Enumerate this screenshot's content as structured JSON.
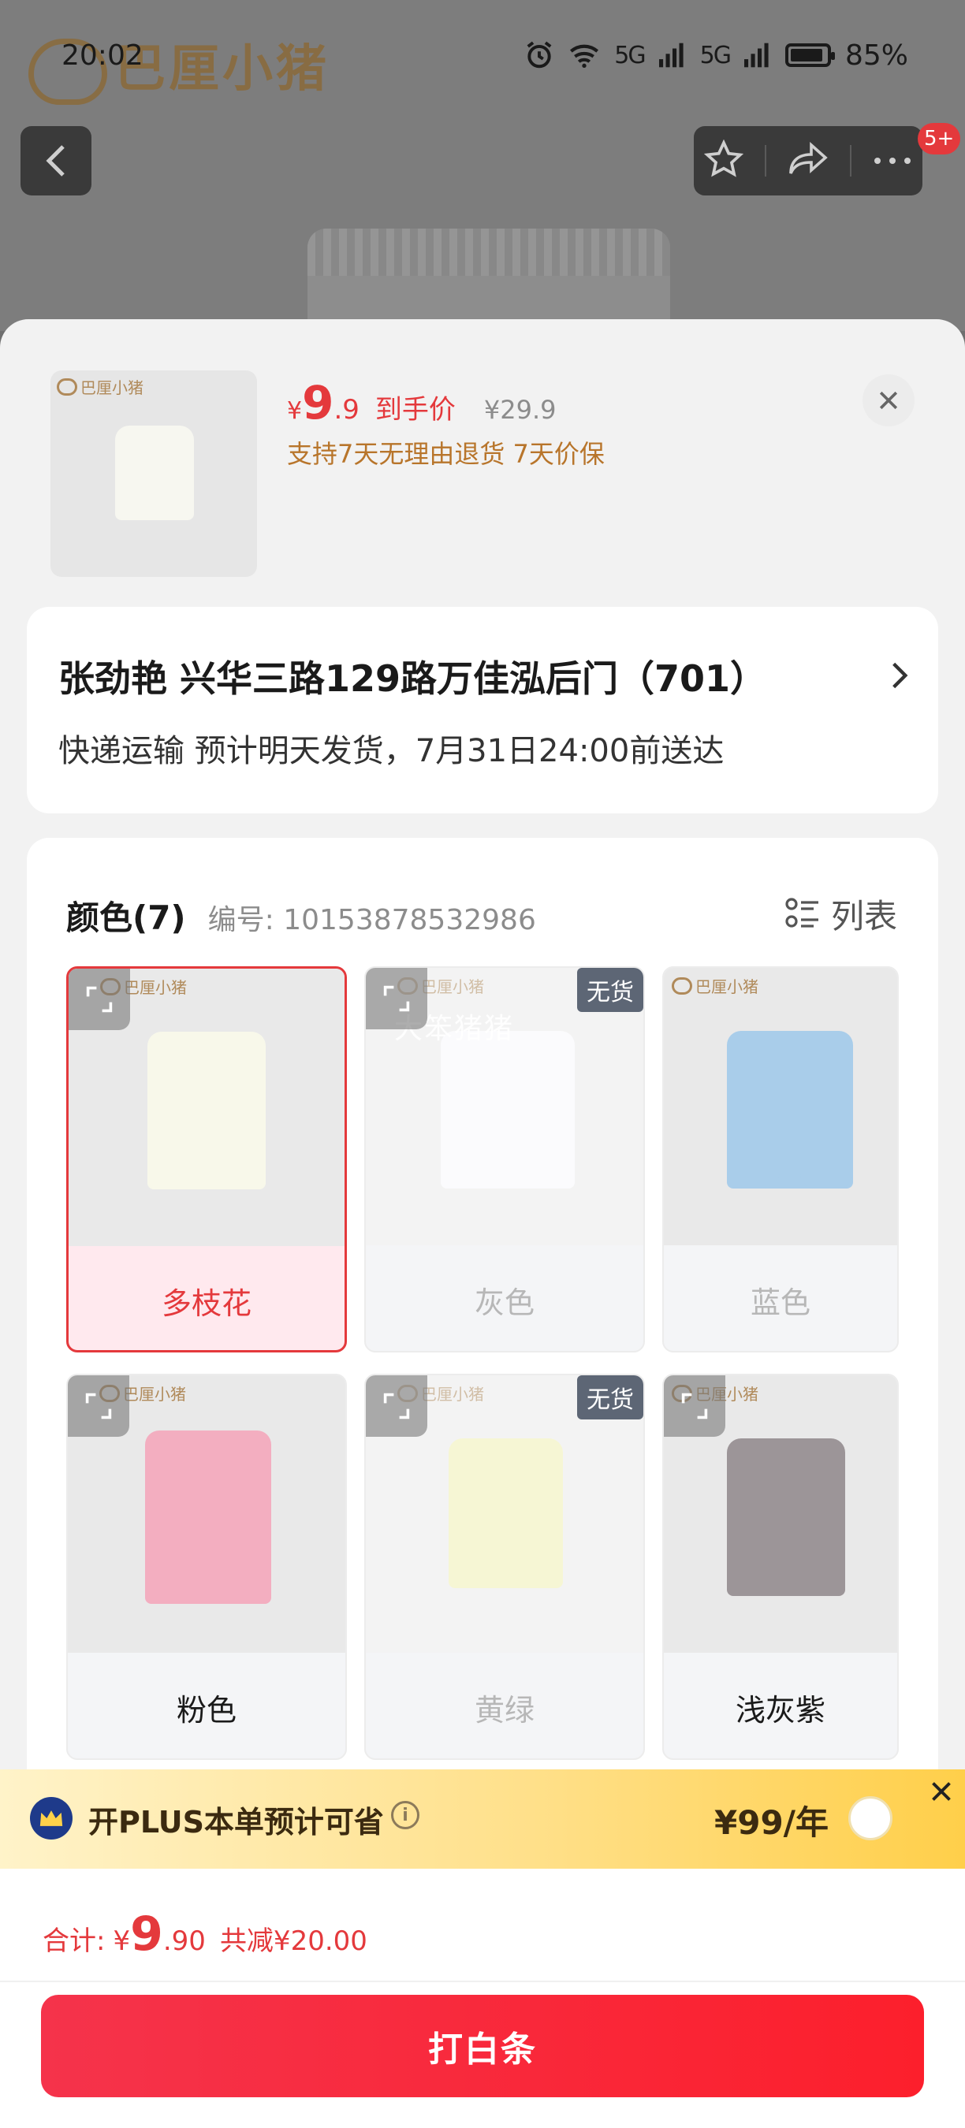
{
  "status_bar": {
    "time": "20:02",
    "signal1": "5G",
    "signal2": "5G",
    "battery": "85%"
  },
  "background": {
    "brand": "巴厘小猪",
    "cart_badge": "5+"
  },
  "summary": {
    "currency": "¥",
    "price_int": "9",
    "price_dec": ".9",
    "price_label": "到手价",
    "original_price": "¥29.9",
    "promise": "支持7天无理由退货  7天价保",
    "thumb_brand": "巴厘小猪"
  },
  "address": {
    "line": "张劲艳  兴华三路129路万佳泓后门（701）",
    "delivery": "快递运输 预计明天发货，7月31日24:00前送达"
  },
  "colors": {
    "title": "颜色(7)",
    "sku": "编号: 10153878532986",
    "list_label": "列表",
    "out_of_stock": "无货",
    "watermark": "大笨猪猪",
    "items": [
      {
        "label": "多枝花",
        "brand": "巴厘小猪"
      },
      {
        "label": "灰色",
        "brand": "巴厘小猪"
      },
      {
        "label": "蓝色",
        "brand": "巴厘小猪"
      },
      {
        "label": "粉色",
        "brand": "巴厘小猪"
      },
      {
        "label": "黄绿",
        "brand": "巴厘小猪"
      },
      {
        "label": "浅灰紫",
        "brand": "巴厘小猪"
      }
    ]
  },
  "plus": {
    "text": "开PLUS本单预计可省",
    "price": "¥99/年"
  },
  "footer": {
    "total_label": "合计:",
    "currency": "¥",
    "total_int": "9",
    "total_dec": ".90",
    "saving": "共减¥20.00",
    "button": "打白条"
  },
  "accent": {
    "red": "#e4393c",
    "gold": "#b8752b"
  }
}
